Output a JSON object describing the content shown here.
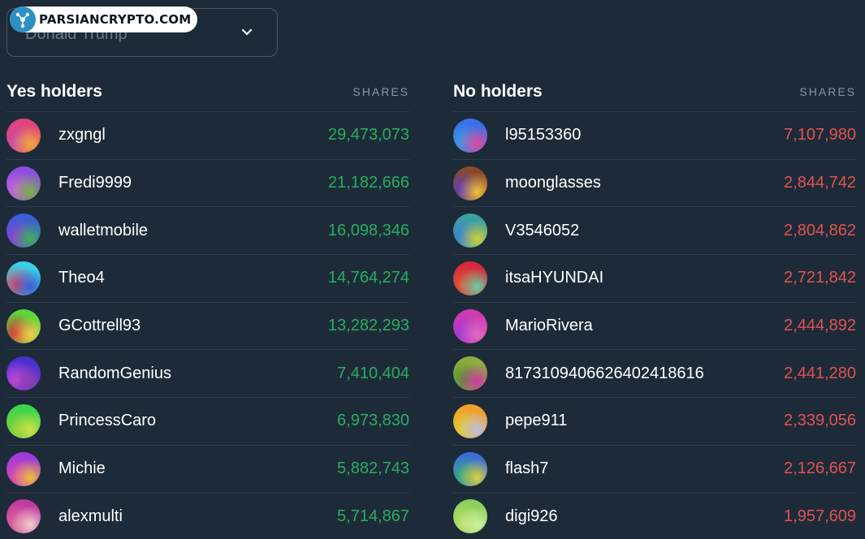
{
  "dropdown": {
    "value": "Donald Trump"
  },
  "watermark": {
    "text": "PARSIANCRYPTO.COM"
  },
  "yes": {
    "title": "Yes holders",
    "shares_label": "SHARES",
    "color": "#27ae60",
    "rows": [
      {
        "name": "zxgngl",
        "shares": "29,473,073",
        "c1": "#e0437a",
        "c2": "#c94fb0",
        "c3": "#f3a93a"
      },
      {
        "name": "Fredi9999",
        "shares": "21,182,666",
        "c1": "#8a4fe0",
        "c2": "#c96ad6",
        "c3": "#7ab04a"
      },
      {
        "name": "walletmobile",
        "shares": "16,098,346",
        "c1": "#3a5fd6",
        "c2": "#9a3fd0",
        "c3": "#3fb05a"
      },
      {
        "name": "Theo4",
        "shares": "14,764,274",
        "c1": "#3ad0e8",
        "c2": "#e03a5a",
        "c3": "#3a5fd6"
      },
      {
        "name": "GCottrell93",
        "shares": "13,282,293",
        "c1": "#5ad63a",
        "c2": "#e0283a",
        "c3": "#f0d04a"
      },
      {
        "name": "RandomGenius",
        "shares": "7,410,404",
        "c1": "#4a2fd0",
        "c2": "#d04ad6",
        "c3": "#8a3fb0"
      },
      {
        "name": "PrincessCaro",
        "shares": "6,973,830",
        "c1": "#3ad64a",
        "c2": "#8ad03a",
        "c3": "#d0e04a"
      },
      {
        "name": "Michie",
        "shares": "5,882,743",
        "c1": "#a03ad6",
        "c2": "#e04ab0",
        "c3": "#f0c03a"
      },
      {
        "name": "alexmulti",
        "shares": "5,714,867",
        "c1": "#c03aa0",
        "c2": "#e06a9a",
        "c3": "#f0d0d0"
      }
    ]
  },
  "no": {
    "title": "No holders",
    "shares_label": "SHARES",
    "color": "#e2524f",
    "rows": [
      {
        "name": "l95153360",
        "shares": "7,107,980",
        "c1": "#3a6fe8",
        "c2": "#3a9fe0",
        "c3": "#e04aa0"
      },
      {
        "name": "moonglasses",
        "shares": "2,844,742",
        "c1": "#8a4a2a",
        "c2": "#5a3ad0",
        "c3": "#f0c03a"
      },
      {
        "name": "V3546052",
        "shares": "2,804,862",
        "c1": "#3aa0a0",
        "c2": "#3a7fd6",
        "c3": "#d0d03a"
      },
      {
        "name": "itsaHYUNDAI",
        "shares": "2,721,842",
        "c1": "#d6283a",
        "c2": "#e05a3a",
        "c3": "#6ad0a0"
      },
      {
        "name": "MarioRivera",
        "shares": "2,444,892",
        "c1": "#d03ab0",
        "c2": "#9a3ad6",
        "c3": "#e06ac0"
      },
      {
        "name": "81731094066264024186​16",
        "shares": "2,441,280",
        "c1": "#8ab03a",
        "c2": "#5a8a3a",
        "c3": "#d03aa0"
      },
      {
        "name": "pepe911",
        "shares": "2,339,056",
        "c1": "#f0a02a",
        "c2": "#e0d03a",
        "c3": "#c0c0e0"
      },
      {
        "name": "flash7",
        "shares": "2,126,667",
        "c1": "#3a6fd6",
        "c2": "#3ab07a",
        "c3": "#e0d03a"
      },
      {
        "name": "digi926",
        "shares": "1,957,609",
        "c1": "#8ad05a",
        "c2": "#c0e06a",
        "c3": "#d0f0a0"
      }
    ]
  }
}
